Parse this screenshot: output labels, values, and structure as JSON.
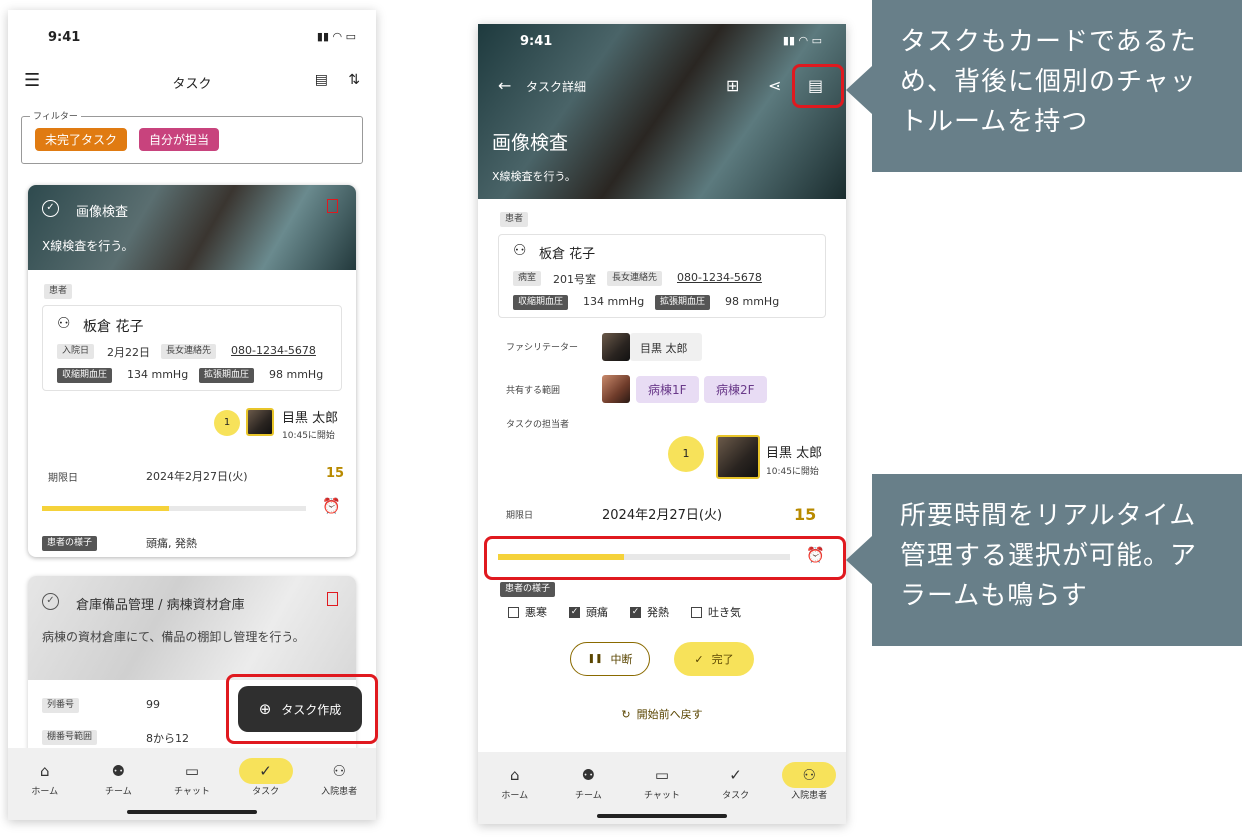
{
  "phone1": {
    "status_time": "9:41",
    "header_title": "タスク",
    "filter_label": "フィルター",
    "filter_chips": [
      "未完了タスク",
      "自分が担当"
    ],
    "card1": {
      "title": "画像検査",
      "desc": "X線検査を行う。",
      "patient_section": "患者",
      "patient_name": "板倉 花子",
      "admit_label": "入院日",
      "admit_value": "2月22日",
      "contact_label": "長女連絡先",
      "contact_value": "080-1234-5678",
      "sys_label": "収縮期血圧",
      "sys_value": "134 mmHg",
      "dia_label": "拡張期血圧",
      "dia_value": "98 mmHg",
      "assignee_count": "1",
      "assignee_name": "目黒 太郎",
      "assignee_time": "10:45に開始",
      "due_label": "期限日",
      "due_value": "2024年2月27日(火)",
      "due_count": "15",
      "progress": 0.48,
      "cond_label": "患者の様子",
      "cond_value": "頭痛, 発熱"
    },
    "card2": {
      "title": "倉庫備品管理 / 病棟資材倉庫",
      "desc": "病棟の資材倉庫にて、備品の棚卸し管理を行う。",
      "col_label": "列番号",
      "col_value": "99",
      "shelf_label": "棚番号範囲",
      "shelf_value": "8から12"
    },
    "fab_label": "タスク作成",
    "nav": [
      "ホーム",
      "チーム",
      "チャット",
      "タスク",
      "入院患者"
    ]
  },
  "phone2": {
    "status_time": "9:41",
    "back_title": "タスク詳細",
    "hero_title": "画像検査",
    "hero_desc": "X線検査を行う。",
    "patient_section": "患者",
    "patient_name": "板倉 花子",
    "room_label": "病室",
    "room_value": "201号室",
    "contact_label": "長女連絡先",
    "contact_value": "080-1234-5678",
    "sys_label": "収縮期血圧",
    "sys_value": "134 mmHg",
    "dia_label": "拡張期血圧",
    "dia_value": "98 mmHg",
    "facilitator_label": "ファシリテーター",
    "facilitator_name": "目黒 太郎",
    "share_label": "共有する範囲",
    "share_chips": [
      "病棟1F",
      "病棟2F"
    ],
    "assignee_section": "タスクの担当者",
    "assignee_count": "1",
    "assignee_name": "目黒 太郎",
    "assignee_time": "10:45に開始",
    "due_label": "期限日",
    "due_value": "2024年2月27日(火)",
    "due_count": "15",
    "progress": 0.43,
    "cond_label": "患者の様子",
    "conditions": [
      {
        "label": "悪寒",
        "checked": false
      },
      {
        "label": "頭痛",
        "checked": true
      },
      {
        "label": "発熱",
        "checked": true
      },
      {
        "label": "吐き気",
        "checked": false
      }
    ],
    "pause_label": "中断",
    "done_label": "完了",
    "reset_label": "開始前へ戻す",
    "nav": [
      "ホーム",
      "チーム",
      "チャット",
      "タスク",
      "入院患者"
    ]
  },
  "callouts": {
    "chat": "タスクもカードであるため、背後に個別のチャットルームを持つ",
    "timer": "所要時間をリアルタイム管理する選択が可能。アラームも鳴らす"
  },
  "colors": {
    "accent": "#f7e25a",
    "orange": "#e07b12",
    "pink": "#c8437d",
    "callout": "#687f89",
    "red": "#e0191f"
  }
}
